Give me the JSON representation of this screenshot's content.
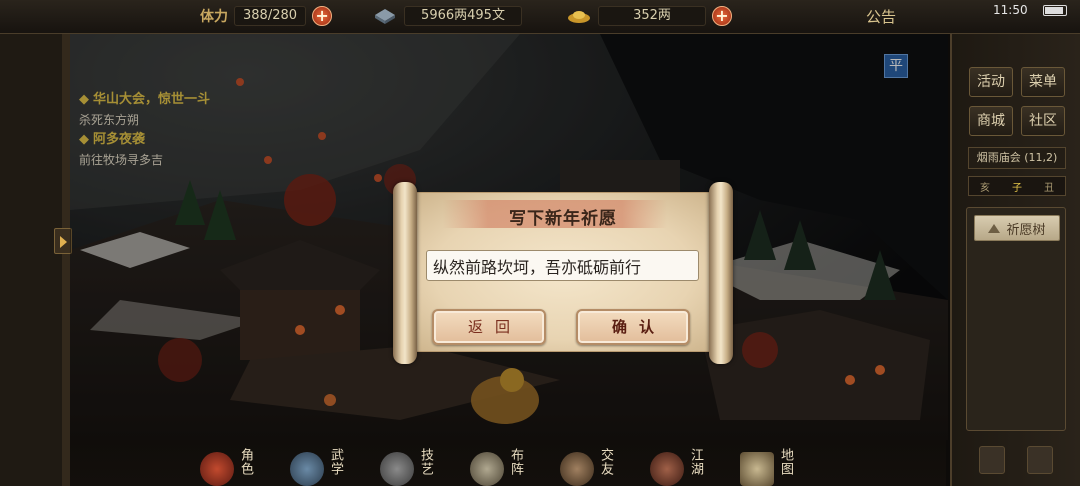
{
  "status_bar": {
    "stamina_label": "体力",
    "stamina_value": "388/280",
    "money_value": "5966两495文",
    "ingot_value": "352两",
    "notice_label": "公告",
    "time": "11:50"
  },
  "quests": [
    {
      "title": "华山大会，惊世一斗",
      "detail": "杀死东方朔"
    },
    {
      "title": "阿多夜袭",
      "detail": "前往牧场寻多吉"
    }
  ],
  "mode_badge": "平",
  "right_menu": {
    "buttons": [
      "活动",
      "菜单",
      "商城",
      "社区"
    ],
    "festival": "烟雨庙会 (11,2)",
    "time_slots": [
      "亥",
      "子",
      "丑"
    ],
    "current_slot_index": 1,
    "wish_tree_label": "祈愿树"
  },
  "bottom_menu": [
    "角色",
    "武学",
    "技艺",
    "布阵",
    "交友",
    "江湖",
    "地图"
  ],
  "dialog": {
    "title": "写下新年祈愿",
    "input_value": "纵然前路坎坷，吾亦砥砺前行",
    "back_label": "返回",
    "confirm_label": "确认"
  },
  "colors": {
    "quest_title": "#e6c64a",
    "button_text": "#7a2e1e",
    "title_band": "#d48c6e",
    "mode_badge": "#2b63a8"
  }
}
